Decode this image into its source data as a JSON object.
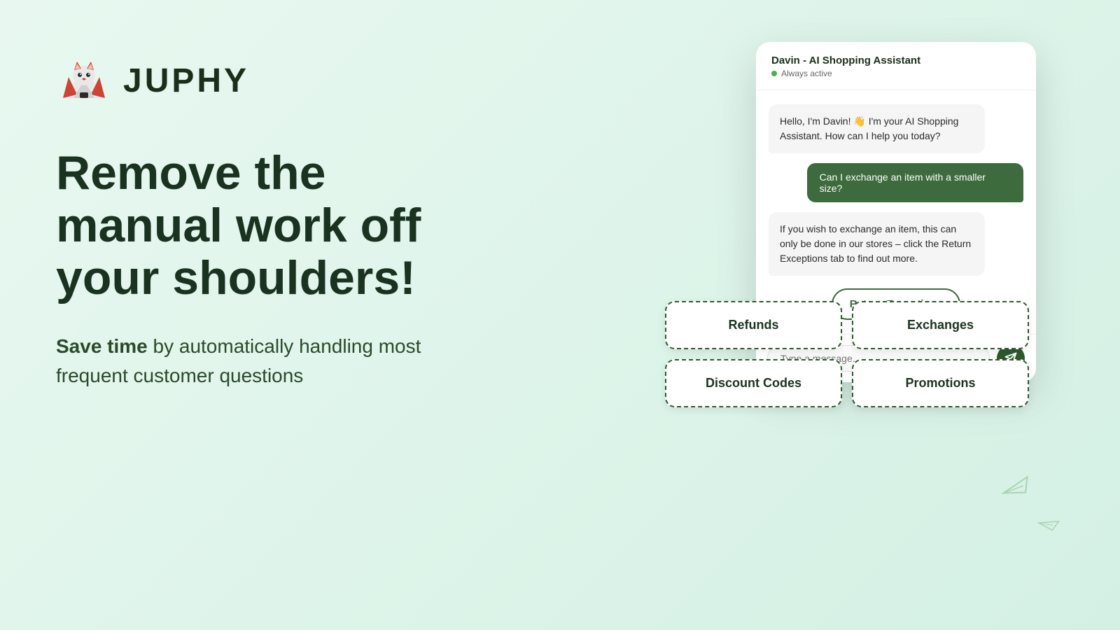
{
  "logo": {
    "brand_name": "JUPHY"
  },
  "left": {
    "headline": "Remove the manual work off your shoulders!",
    "subtext_bold": "Save time",
    "subtext_regular": " by automatically handling most frequent customer questions"
  },
  "chat": {
    "header": {
      "name": "Davin - AI Shopping Assistant",
      "status": "Always active"
    },
    "messages": [
      {
        "type": "bot",
        "text": "Hello, I'm Davin! 👋 I'm your AI Shopping Assistant. How can I help you today?"
      },
      {
        "type": "user",
        "text": "Can I exchange an item with a smaller size?"
      },
      {
        "type": "bot",
        "text": "If you wish to exchange an item, this can only be done in our stores – click the Return Exceptions tab to find out more."
      }
    ],
    "return_exceptions_button": "Return Exceptions",
    "quick_replies": [
      "Refunds",
      "Exchanges",
      "Discount Codes",
      "Promotions"
    ],
    "input_placeholder": "Type a message...",
    "send_icon": "➤"
  }
}
